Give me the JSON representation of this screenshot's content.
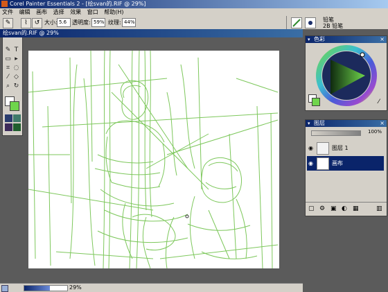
{
  "window": {
    "title": "Corel Painter Essentials 2 - [绘svan的.RIF @ 29%]"
  },
  "menu": [
    "文件",
    "编辑",
    "画布",
    "选择",
    "效果",
    "窗口",
    "帮助(H)"
  ],
  "propbar": {
    "size_label": "大小:",
    "size_value": "5.6",
    "opacity_label": "透明度:",
    "opacity_value": "59%",
    "grain_label": "纹理:",
    "grain_value": "44%"
  },
  "brush": {
    "category": "铅笔",
    "variant": "2B 铅笔"
  },
  "document": {
    "title": "绘svan的.RIF @ 29%"
  },
  "status": {
    "zoom": "29%"
  },
  "color_panel": {
    "title": "色彩",
    "accent_color": "#6fd54c"
  },
  "layers_panel": {
    "title": "图层",
    "opacity": "100%",
    "layers": [
      {
        "name": "图层 1",
        "selected": false
      },
      {
        "name": "画布",
        "selected": true
      }
    ]
  },
  "colors": {
    "sketch_stroke": "#6fc24a",
    "title_bar": "#0a246a",
    "selected_layer": "#0a246a"
  }
}
